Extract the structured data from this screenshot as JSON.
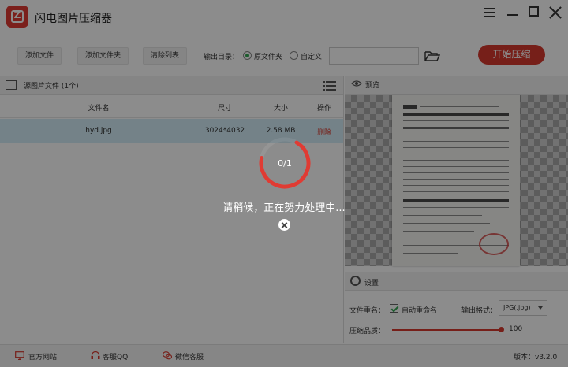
{
  "app": {
    "title": "闪电图片压缩器"
  },
  "toolbar": {
    "add_file": "添加文件",
    "add_folder": "添加文件夹",
    "clear_list": "清除列表",
    "output_dir_label": "输出目录：",
    "option_original": "原文件夹",
    "option_custom": "自定义",
    "path_value": "",
    "start_label": "开始压缩"
  },
  "file_panel": {
    "title": "源图片文件 (1个)",
    "columns": [
      "文件名",
      "尺寸",
      "大小",
      "操作"
    ],
    "rows": [
      {
        "name": "hyd.jpg",
        "size": "3024*4032",
        "filesize": "2.58 MB",
        "action": "删除"
      }
    ]
  },
  "preview": {
    "title": "预览"
  },
  "settings": {
    "title": "设置",
    "rename_label": "文件重名：",
    "auto_rename": "自动重命名",
    "format_label": "输出格式：",
    "format_value": "JPG(.jpg)",
    "quality_label": "压缩品质：",
    "quality_value": "100"
  },
  "footer": {
    "website": "官方网站",
    "qq": "客服QQ",
    "wechat": "微信客服",
    "version": "版本：v3.2.0"
  },
  "overlay": {
    "progress": "0/1",
    "progress_fraction": 0.7,
    "message": "请稍候，正在努力处理中..."
  },
  "colors": {
    "accent": "#d83a2e",
    "success": "#35a855",
    "selected_row": "#d4edf7"
  }
}
